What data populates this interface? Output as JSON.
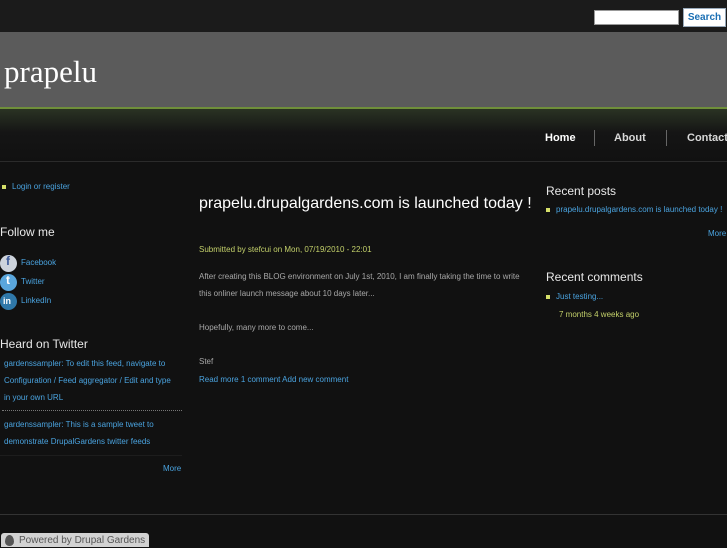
{
  "search": {
    "value": "",
    "button_label": "Search"
  },
  "site": {
    "name": "prapelu"
  },
  "nav": {
    "items": [
      "Home",
      "About",
      "Contact"
    ]
  },
  "left_sidebar": {
    "login_label": "Login or register",
    "follow": {
      "title": "Follow me",
      "items": [
        {
          "label": "Facebook",
          "icon": "facebook-icon"
        },
        {
          "label": "Twitter",
          "icon": "twitter-icon"
        },
        {
          "label": "LinkedIn",
          "icon": "linkedin-icon"
        }
      ]
    },
    "twitter": {
      "title": "Heard on Twitter",
      "tweets": [
        "gardenssampler: To edit this feed, navigate to Configuration / Feed aggregator / Edit and type in your own URL",
        "gardenssampler: This is a sample tweet to demonstrate DrupalGardens twitter feeds"
      ],
      "more_label": "More"
    }
  },
  "post": {
    "title": "prapelu.drupalgardens.com is launched today !",
    "meta": "Submitted by stefcui on Mon, 07/19/2010 - 22:01",
    "paragraphs": [
      "After creating this BLOG environment on July 1st, 2010, I am finally taking the time to write this onliner launch message about 10 days later...",
      "Hopefully, many more to come...",
      "Stef"
    ],
    "links": {
      "read_more": "Read more",
      "comment": "1 comment",
      "add_comment": "Add new comment"
    }
  },
  "right_sidebar": {
    "recent_posts": {
      "title": "Recent posts",
      "items": [
        "prapelu.drupalgardens.com is launched today !"
      ],
      "more_label": "More"
    },
    "recent_comments": {
      "title": "Recent comments",
      "items": [
        {
          "text": "Just testing...",
          "time": "7 months 4 weeks ago"
        }
      ]
    }
  },
  "footer": {
    "powered_label": "Powered by Drupal Gardens",
    "icon": "drupal-drop-icon"
  },
  "colors": {
    "link": "#4aa3df",
    "accent_green": "#6f8f3a",
    "meta_green": "#c3d06a",
    "header_bg": "#5b5b5b",
    "page_bg": "#111111"
  }
}
